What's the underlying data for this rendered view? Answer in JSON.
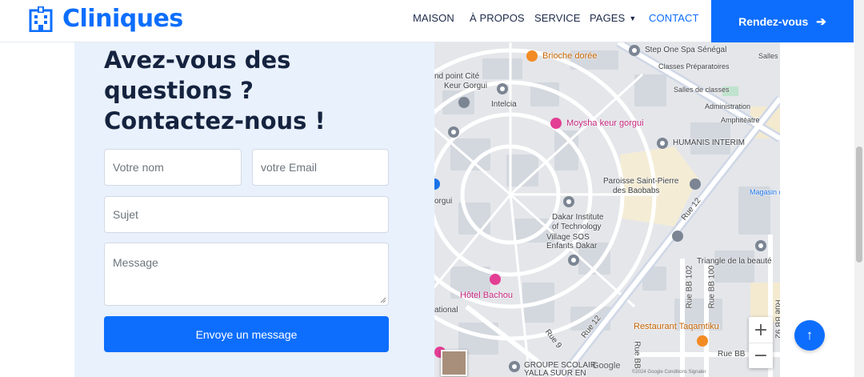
{
  "brand": {
    "name": "Cliniques",
    "icon": "hospital-building-icon",
    "color": "#0d6efd"
  },
  "nav": {
    "items": [
      {
        "label": "MAISON",
        "active": false
      },
      {
        "label": "À PROPOS",
        "active": false
      },
      {
        "label": "SERVICE",
        "active": false
      },
      {
        "label": "PAGES",
        "active": false,
        "dropdown": true
      },
      {
        "label": "CONTACT",
        "active": true
      }
    ],
    "cta_label": "Rendez-vous",
    "cta_icon": "arrow-right-icon"
  },
  "contact": {
    "title": "Avez-vous des questions ? Contactez-nous !",
    "name_placeholder": "Votre nom",
    "email_placeholder": "votre Email",
    "subject_placeholder": "Sujet",
    "message_placeholder": "Message",
    "submit_label": "Envoye un message"
  },
  "map": {
    "labels": {
      "brioche": "Brioche dorée",
      "step_one": "Step One Spa Sénégal",
      "salles": "Salles",
      "classes_prep": "Classes Préparatoires",
      "point_cite": "nd point Cité",
      "keur_gorgui": "Keur Gorgui",
      "salles_classes": "Salles de classes",
      "intelcia": "Intelcia",
      "administration": "Administration",
      "amphitheatre": "Amphitéatre",
      "moysha": "Moysha keur gorgui",
      "humanis": "HUMANIS INTERIM",
      "paroisse_1": "Paroisse Saint-Pierre",
      "paroisse_2": "des Baobabs",
      "magasin": "Magasin c",
      "gorgui": "orgui",
      "rue12_a": "Rue 12",
      "dakar_inst_1": "Dakar Institute",
      "dakar_inst_2": "of Technology",
      "village_1": "Village SOS",
      "village_2": "Enfants Dakar",
      "triangle": "Triangle de la beauté",
      "rue_bb102": "Rue BB 102",
      "rue_bb100": "Rue BB 100",
      "hotel": "Hôtel Bachou",
      "national": "ational",
      "restaurant": "Restaurant Taqamtiku",
      "rue12_b": "Rue 12",
      "rue9": "Rue 9",
      "rue_bb": "Rue BB",
      "rue_bb_v": "Rue BB",
      "rue_bb92": "Rue BB 92",
      "groupe_1": "GROUPE SCOLAIR",
      "groupe_2": "YALLA SUUR EN",
      "google": "Google",
      "footer": "©2024 Google  Conditions  Signaler"
    },
    "zoom_in": "+",
    "zoom_out": "−"
  },
  "back_to_top_icon": "arrow-up-icon"
}
